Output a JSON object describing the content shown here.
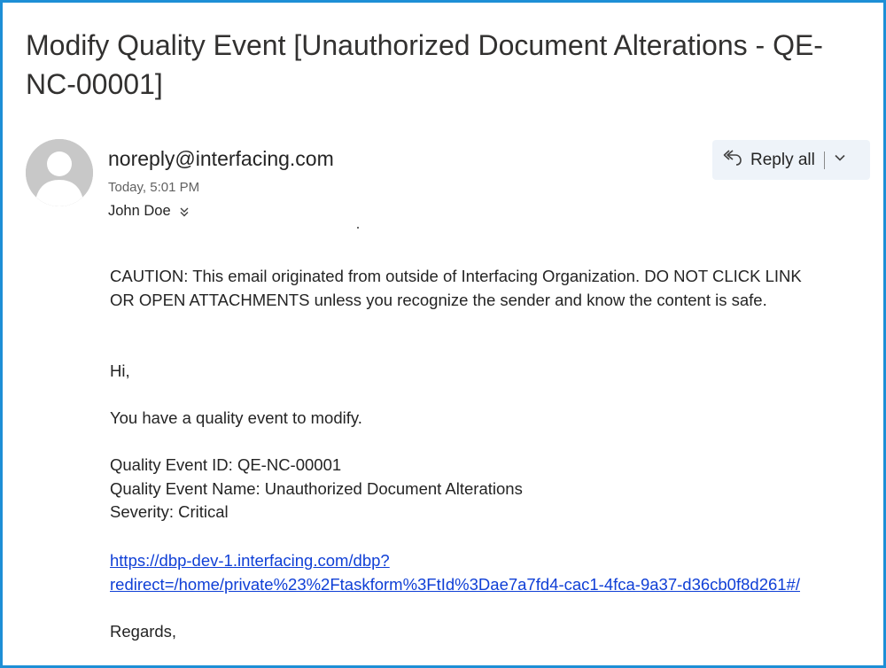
{
  "email": {
    "subject": "Modify Quality Event [Unauthorized Document Alterations - QE-NC-00001]",
    "sender": "noreply@interfacing.com",
    "timestamp": "Today, 5:01 PM",
    "recipient": "John Doe",
    "reply_all_label": "Reply all",
    "icons": {
      "avatar": "person-avatar-icon",
      "reply_all": "reply-all-icon",
      "expand_recipients": "double-chevron-down-icon",
      "more_options": "chevron-down-icon"
    }
  },
  "body": {
    "caution_line1": "CAUTION: This email originated from outside of Interfacing Organization. DO NOT CLICK LINK",
    "caution_line2": "OR OPEN ATTACHMENTS unless you recognize the sender and know the content is safe.",
    "greeting": "Hi,",
    "intro": "You have a quality event to modify.",
    "event_id": "Quality Event ID: QE-NC-00001",
    "event_name": "Quality Event Name: Unauthorized Document Alterations",
    "severity": "Severity: Critical",
    "link_line1": "https://dbp-dev-1.interfacing.com/dbp?",
    "link_line2": "redirect=/home/private%23%2Ftaskform%3FtId%3Dae7a7fd4-cac1-4fca-9a37-d36cb0f8d261#/",
    "closing": "Regards,"
  },
  "colors": {
    "frame_border": "#1e8fd6",
    "link": "#0f3fd6",
    "reply_bg": "#eef3f9",
    "avatar_bg": "#c8c8c8"
  }
}
